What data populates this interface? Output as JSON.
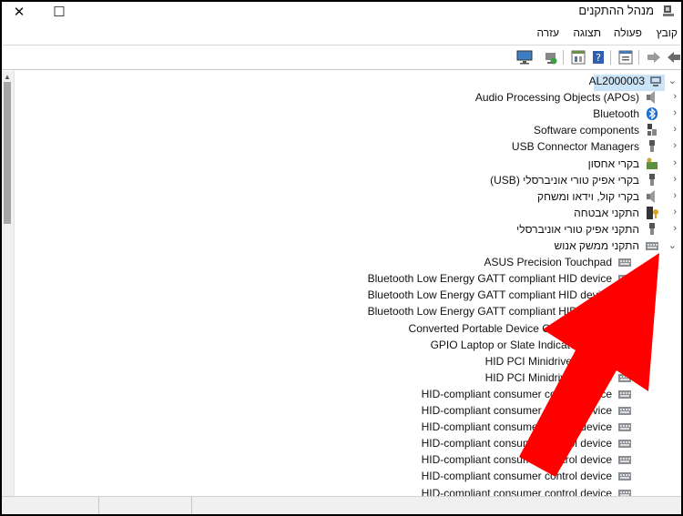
{
  "window": {
    "title": "מנהל ההתקנים",
    "close_glyph": "✕",
    "maximize_glyph": "☐"
  },
  "menu": {
    "file": "קובץ",
    "action": "פעולה",
    "view": "תצוגה",
    "help": "עזרה"
  },
  "toolbar": {
    "icons": [
      "back-arrow-icon",
      "forward-arrow-icon",
      "properties-icon",
      "help-icon",
      "view-icon",
      "update-driver-icon",
      "scan-hardware-icon"
    ]
  },
  "tree": {
    "root": "AL2000003",
    "categories": [
      "Audio Processing Objects (APOs)",
      "Bluetooth",
      "Software components",
      "USB Connector Managers",
      "בקרי אחסון",
      "בקרי אפיק טורי אוניברסלי (USB)",
      "בקרי קול, וידאו ומשחק",
      "התקני אבטחה",
      "התקני אפיק טורי אוניברסלי",
      "התקני ממשק אנוש"
    ],
    "children": [
      "ASUS Precision Touchpad",
      "Bluetooth Low Energy GATT compliant HID device",
      "Bluetooth Low Energy GATT compliant HID device",
      "Bluetooth Low Energy GATT compliant HID device",
      "Converted Portable Device Control device",
      "GPIO Laptop or Slate Indicator Driver",
      "HID PCI Minidriver for ISS",
      "HID PCI Minidriver for ISS",
      "HID-compliant consumer control device",
      "HID-compliant consumer control device",
      "HID-compliant consumer control device",
      "HID-compliant consumer control device",
      "HID-compliant consumer control device",
      "HID-compliant consumer control device",
      "HID-compliant consumer control device"
    ]
  },
  "colors": {
    "selection": "#cce4f7",
    "annotation_arrow": "#ff0000"
  }
}
